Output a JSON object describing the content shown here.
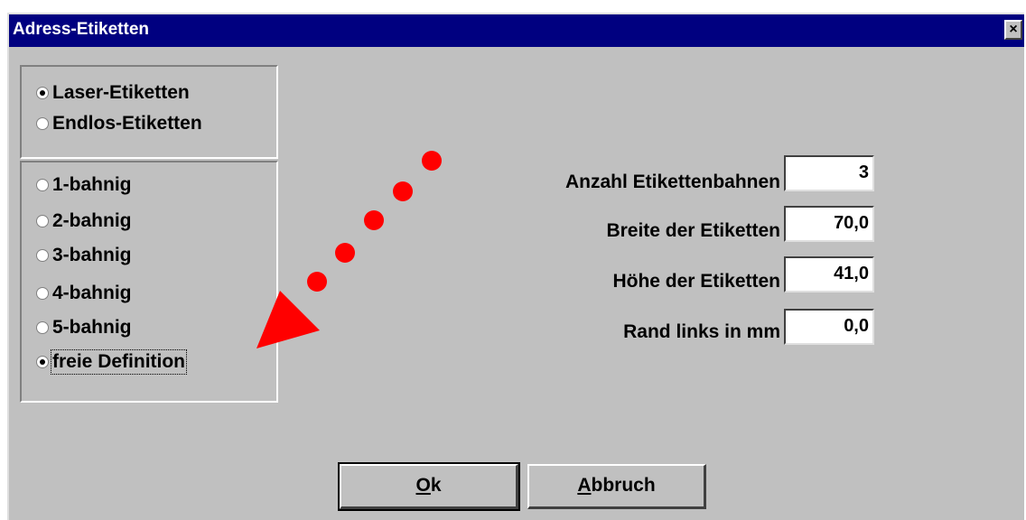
{
  "window": {
    "title": "Adress-Etiketten",
    "close_label": "×"
  },
  "label_type": {
    "options": [
      {
        "label": "Laser-Etiketten",
        "selected": true
      },
      {
        "label": "Endlos-Etiketten",
        "selected": false
      }
    ]
  },
  "tracks": {
    "options": [
      {
        "label": "1-bahnig",
        "selected": false
      },
      {
        "label": "2-bahnig",
        "selected": false
      },
      {
        "label": "3-bahnig",
        "selected": false
      },
      {
        "label": "4-bahnig",
        "selected": false
      },
      {
        "label": "5-bahnig",
        "selected": false
      },
      {
        "label": "freie Definition",
        "selected": true
      }
    ]
  },
  "fields": {
    "count": {
      "label": "Anzahl Etikettenbahnen",
      "value": "3"
    },
    "width": {
      "label": "Breite der Etiketten",
      "value": "70,0"
    },
    "height": {
      "label": "Höhe der Etiketten",
      "value": "41,0"
    },
    "margin": {
      "label": "Rand links in mm",
      "value": "0,0"
    }
  },
  "buttons": {
    "ok_first": "O",
    "ok_rest": "k",
    "cancel_first": "A",
    "cancel_rest": "bbruch"
  },
  "annotation": {
    "color": "#ff0000",
    "icon": "red-dotted-arrow"
  }
}
